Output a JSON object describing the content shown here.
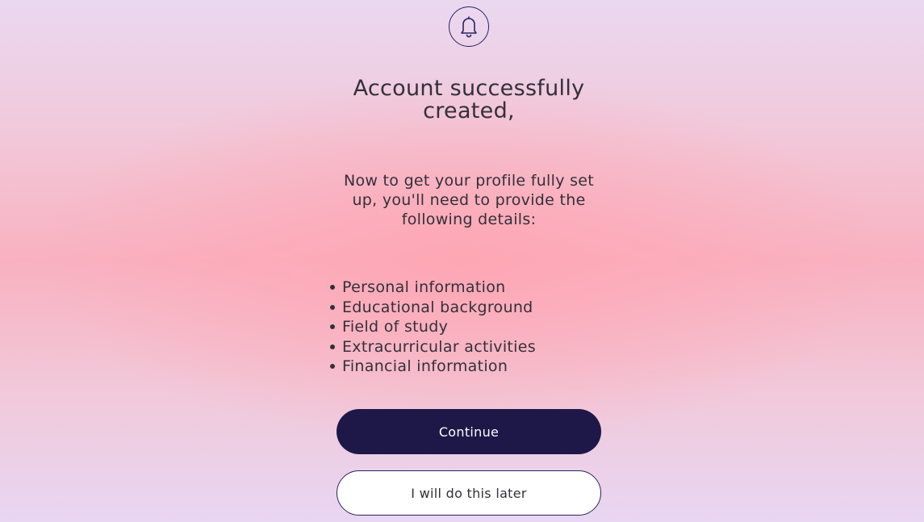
{
  "header": {
    "icon": "bell-icon",
    "icon_color": "#2a2363"
  },
  "main": {
    "title": "Account successfully created,",
    "intro": "Now to get your profile fully set up, you'll need to provide the following details:",
    "details": [
      "Personal information",
      "Educational background",
      "Field of study",
      "Extracurricular activities",
      "Financial information"
    ]
  },
  "actions": {
    "continue_label": "Continue",
    "later_label": "I will do this later",
    "primary_color": "#1e1848"
  }
}
